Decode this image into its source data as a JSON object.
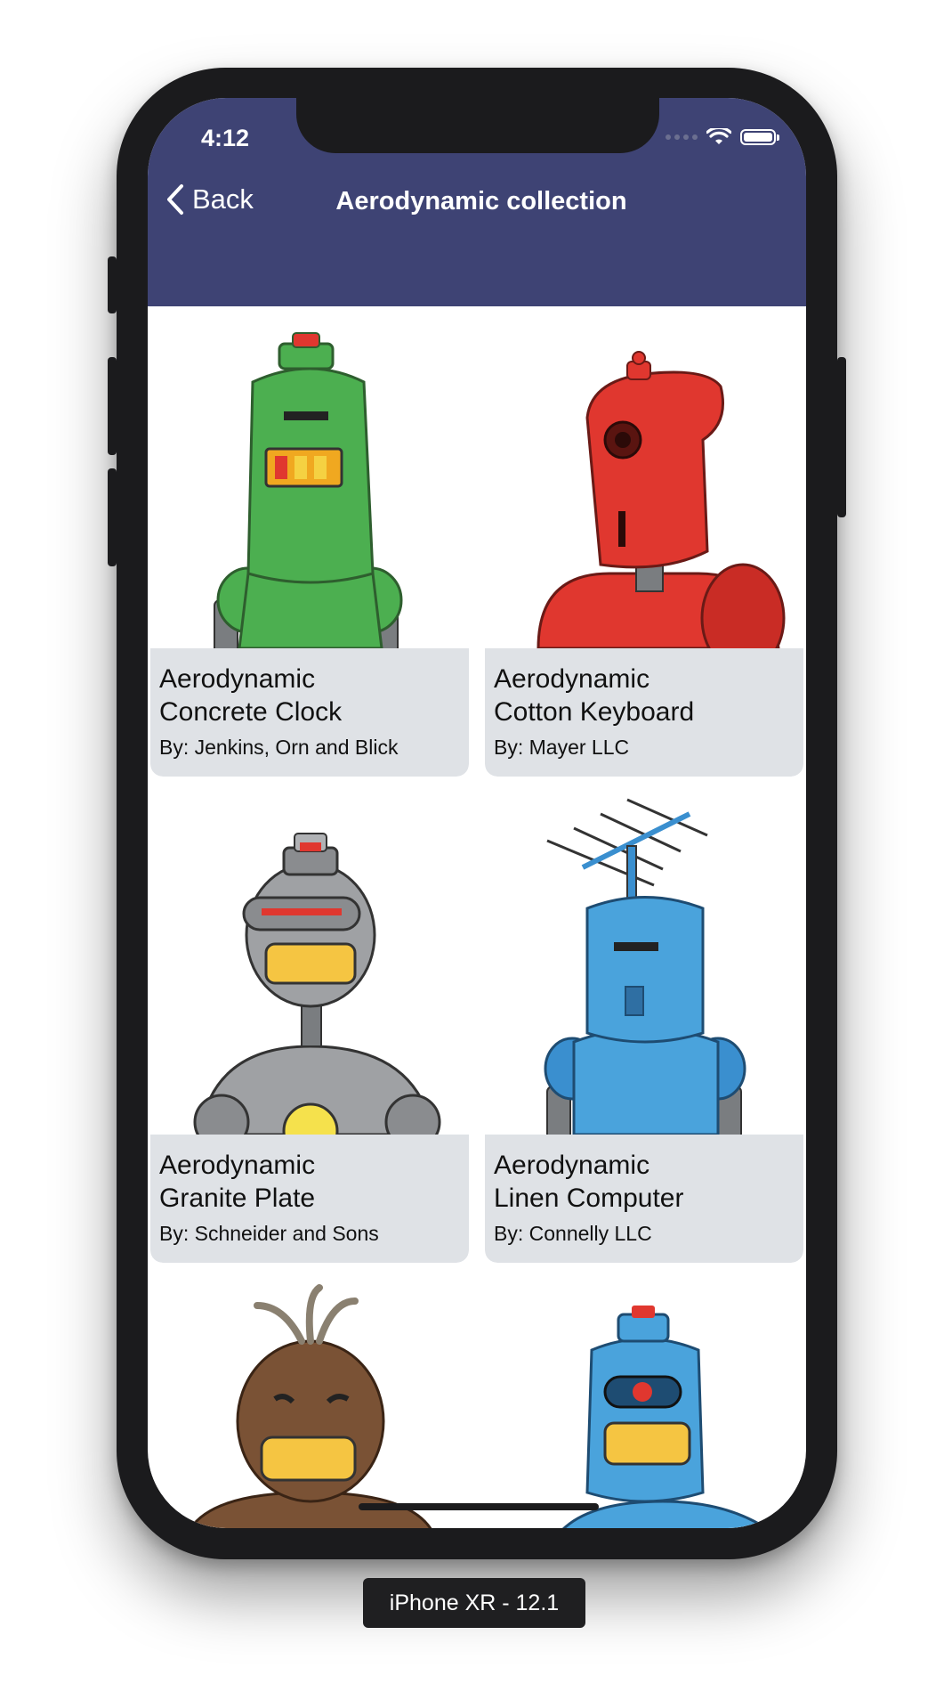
{
  "status_bar": {
    "time": "4:12"
  },
  "nav": {
    "back_label": "Back",
    "title": "Aerodynamic collection"
  },
  "products": [
    {
      "name_line1": "Aerodynamic",
      "name_line2": "Concrete Clock",
      "maker": "By: Jenkins, Orn and Blick",
      "robot_color": "#4caf50",
      "icon": "green-robot-image"
    },
    {
      "name_line1": "Aerodynamic",
      "name_line2": "Cotton Keyboard",
      "maker": "By: Mayer LLC",
      "robot_color": "#e0372f",
      "icon": "red-robot-image"
    },
    {
      "name_line1": "Aerodynamic",
      "name_line2": "Granite Plate",
      "maker": "By: Schneider and Sons",
      "robot_color": "#9fa1a4",
      "icon": "gray-robot-image"
    },
    {
      "name_line1": "Aerodynamic",
      "name_line2": "Linen Computer",
      "maker": "By: Connelly LLC",
      "robot_color": "#4aa3dc",
      "icon": "blue-antenna-robot-image"
    },
    {
      "robot_color": "#7a5235",
      "icon": "brown-robot-image"
    },
    {
      "robot_color": "#4aa3dc",
      "icon": "blue-robot-image"
    }
  ],
  "device_label": "iPhone XR - 12.1"
}
